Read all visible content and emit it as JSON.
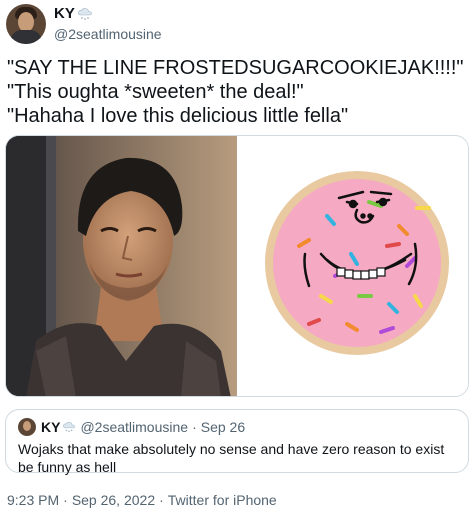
{
  "author": {
    "display_name": "KY",
    "handle": "@2seatlimousine",
    "badge_icon": "cloud-snow-icon"
  },
  "tweet": {
    "lines": [
      "\"SAY THE LINE FROSTEDSUGARCOOKIEJAK!!!!\"",
      "\"This oughta *sweeten* the deal!\"",
      "\"Hahaha I love this delicious little fella\""
    ]
  },
  "media": {
    "left_image": "photo-of-man",
    "right_image": "frosted-sugar-cookie-wojak"
  },
  "quote": {
    "display_name": "KY",
    "handle": "@2seatlimousine",
    "separator": "·",
    "date": "Sep 26",
    "text": "Wojaks that make absolutely no sense and have zero reason to exist be funny as hell"
  },
  "meta": {
    "time": "9:23 PM",
    "separator1": "·",
    "date": "Sep 26, 2022",
    "separator2": "·",
    "source": "Twitter for iPhone"
  },
  "colors": {
    "text_primary": "#0f1419",
    "text_secondary": "#536471",
    "border": "#cfd9de",
    "cookie_frosting": "#f5a9c3",
    "cookie_base": "#e8c9a0"
  }
}
